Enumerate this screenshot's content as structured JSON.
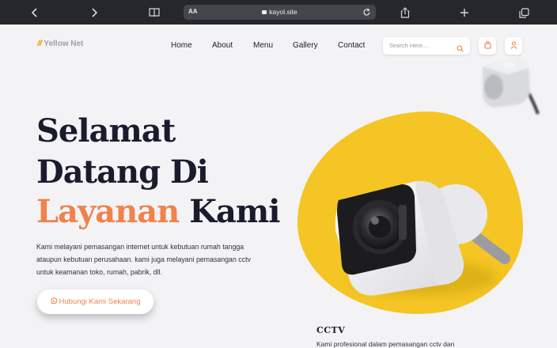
{
  "browser": {
    "text_size_label": "AA",
    "url": "kayol.site"
  },
  "site": {
    "logo_text": "Yellow Net",
    "nav": [
      {
        "label": "Home"
      },
      {
        "label": "About"
      },
      {
        "label": "Menu"
      },
      {
        "label": "Gallery"
      },
      {
        "label": "Contact"
      }
    ],
    "search_placeholder": "Search Here..."
  },
  "hero": {
    "title_line1": "Selamat",
    "title_line2": "Datang Di",
    "title_accent": "Layanan",
    "title_end": "Kami",
    "description": "Kami melayani pemasangan internet untuk kebutuan rumah tangga ataupun kebutuan perusahaan. kami juga melayani pemasangan cctv untuk keamanan toko, rumah, pabrik, dll.",
    "cta_label": "Hubungi Kami Sekarang"
  },
  "service": {
    "title": "CCTV",
    "description": "Kami profesional dalam pemasangan cctv dan"
  },
  "colors": {
    "accent": "#f0824a",
    "brand_yellow": "#f4c524",
    "heading": "#1b1b2e",
    "chrome": "#26272c"
  }
}
